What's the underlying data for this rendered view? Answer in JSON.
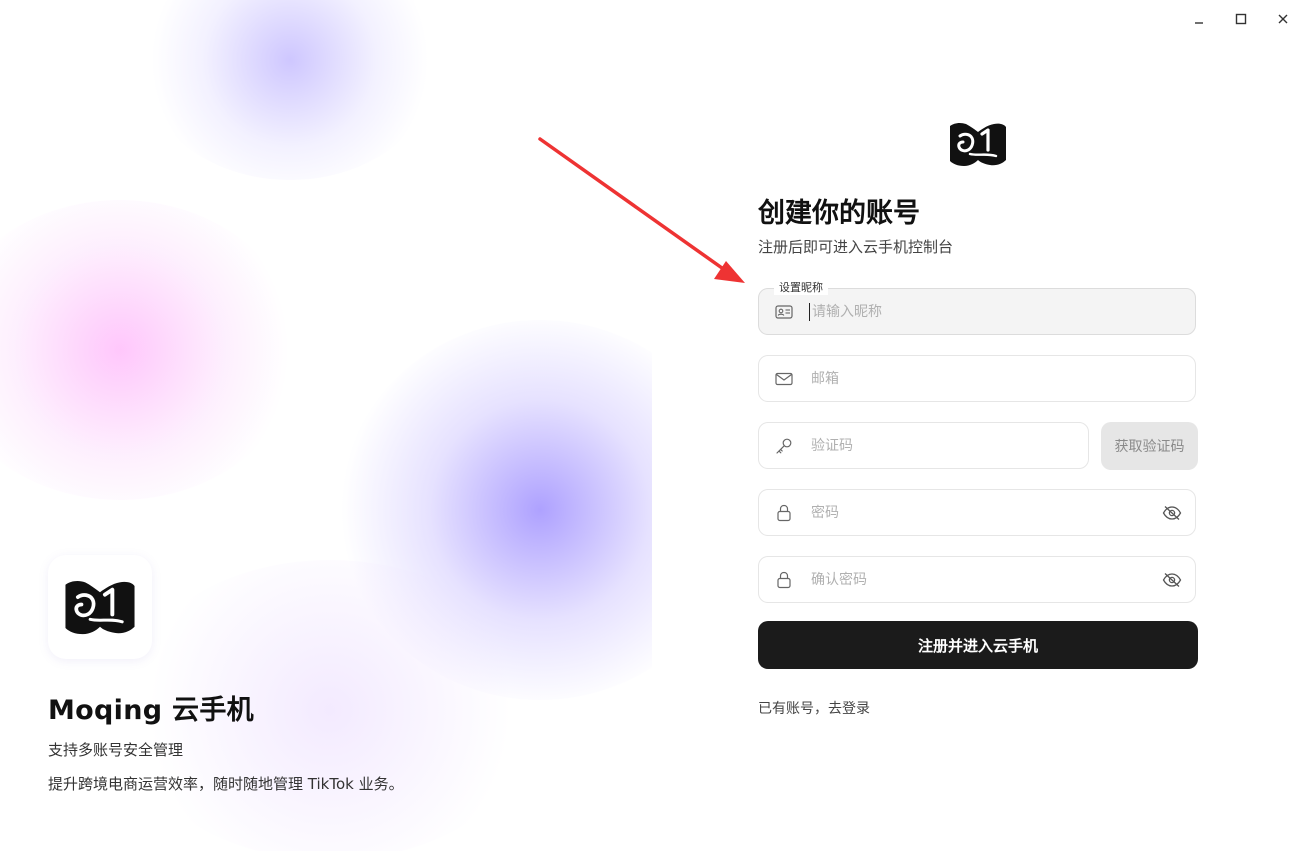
{
  "window": {
    "controls": {
      "minimize": "_",
      "maximize": "☐",
      "close": "✕"
    }
  },
  "hero": {
    "title": "Moqing 云手机",
    "subtitle1": "支持多账号安全管理",
    "subtitle2": "提升跨境电商运营效率，随时随地管理 TikTok 业务。"
  },
  "form": {
    "title": "创建你的账号",
    "subtitle": "注册后即可进入云手机控制台",
    "nickname": {
      "label": "设置昵称",
      "placeholder": "请输入昵称",
      "value": ""
    },
    "email": {
      "placeholder": "邮箱"
    },
    "code": {
      "placeholder": "验证码",
      "button": "获取验证码"
    },
    "password": {
      "placeholder": "密码"
    },
    "confirm_password": {
      "placeholder": "确认密码"
    },
    "submit": "注册并进入云手机",
    "login_link": "已有账号，去登录"
  },
  "colors": {
    "annotation_arrow": "#ee3333",
    "primary_button": "#1b1b1b",
    "disabled_button": "#e6e6e6"
  }
}
